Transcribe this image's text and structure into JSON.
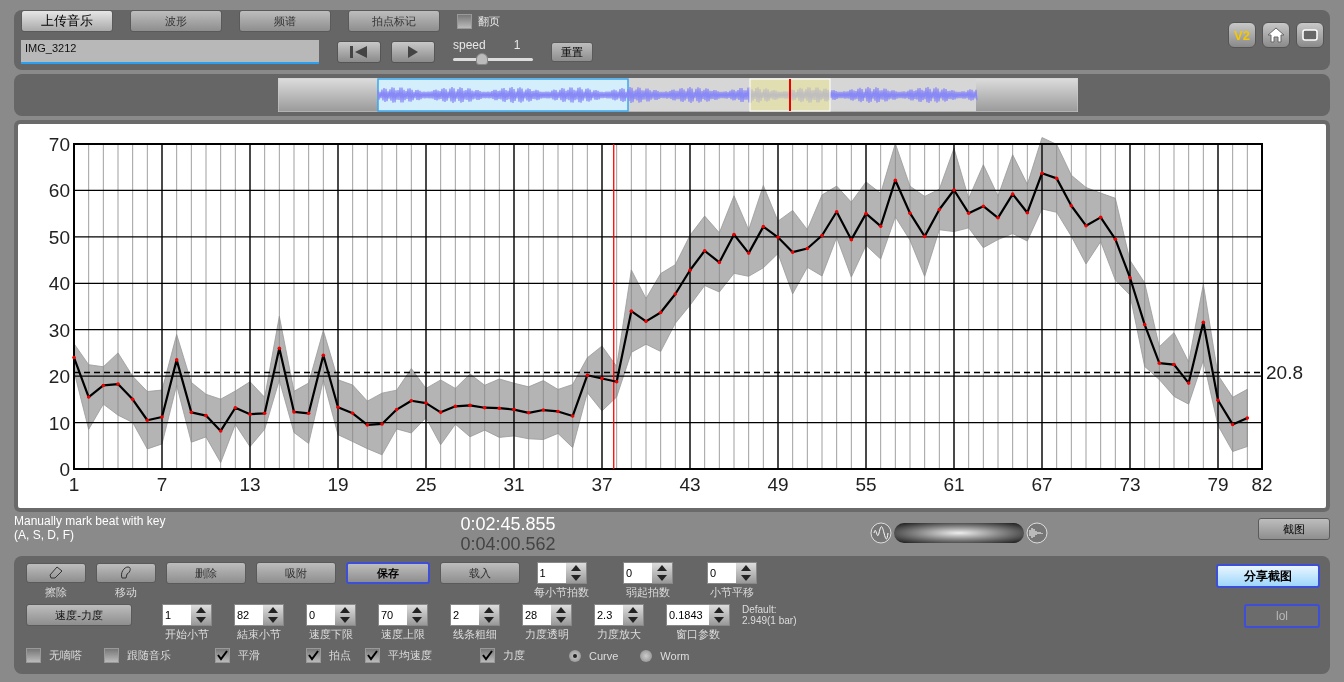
{
  "toolbar": {
    "buttons": [
      {
        "label": "上传音乐",
        "selected": true
      },
      {
        "label": "波形",
        "selected": false
      },
      {
        "label": "频谱",
        "selected": false
      },
      {
        "label": "拍点标记",
        "selected": false
      }
    ],
    "page_flip": {
      "label": "翻页",
      "checked": false
    },
    "file_name": "IMG_3212",
    "speed": {
      "label": "speed",
      "value": "1",
      "level": 0.35
    },
    "reset": "重置",
    "version": "V2"
  },
  "chart": {
    "chart_data": {
      "type": "line",
      "grid": true,
      "x": [
        1,
        2,
        3,
        4,
        5,
        6,
        7,
        8,
        9,
        10,
        11,
        12,
        13,
        14,
        15,
        16,
        17,
        18,
        19,
        20,
        21,
        22,
        23,
        24,
        25,
        26,
        27,
        28,
        29,
        30,
        31,
        32,
        33,
        34,
        35,
        36,
        37,
        38,
        39,
        40,
        41,
        42,
        43,
        44,
        45,
        46,
        47,
        48,
        49,
        50,
        51,
        52,
        53,
        54,
        55,
        56,
        57,
        58,
        59,
        60,
        61,
        62,
        63,
        64,
        65,
        66,
        67,
        68,
        69,
        70,
        71,
        72,
        73,
        74,
        75,
        76,
        77,
        78,
        79,
        80,
        81
      ],
      "series": [
        {
          "color": "#000000",
          "values": [
            24,
            15.5,
            18,
            18.3,
            15,
            10.5,
            11.2,
            23.5,
            12.2,
            11.5,
            8.2,
            13.2,
            11.8,
            12,
            26,
            12.3,
            12,
            24.5,
            13.3,
            12,
            9.5,
            9.7,
            12.8,
            14.7,
            14.2,
            12.2,
            13.5,
            13.7,
            13.2,
            13.1,
            12.8,
            12.1,
            12.7,
            12.4,
            11.4,
            20.2,
            19.5,
            18.8,
            34,
            31.8,
            33.7,
            37.7,
            42.8,
            47,
            44.5,
            50.5,
            46.5,
            52.2,
            49.9,
            46.7,
            47.5,
            50.3,
            55.4,
            49.4,
            55,
            52.3,
            62.2,
            55.1,
            50.1,
            55.9,
            60.1,
            55.1,
            56.6,
            54.1,
            59.2,
            55.2,
            63.7,
            62.6,
            56.7,
            52.4,
            54.2,
            49.5,
            41.2,
            31.1,
            22.8,
            22.5,
            18.5,
            31.6,
            14.8,
            9.6,
            11
          ]
        }
      ],
      "xlim": [
        1,
        82
      ],
      "ylim": [
        0,
        70
      ],
      "xticks": [
        1,
        7,
        13,
        19,
        25,
        31,
        37,
        43,
        49,
        55,
        61,
        67,
        73,
        79,
        82
      ],
      "yticks": [
        0,
        10,
        20,
        30,
        40,
        50,
        60,
        70
      ],
      "ref_lines": [
        {
          "axis": "y",
          "value": 20.8,
          "label": "20.8"
        },
        {
          "axis": "x",
          "value": 37.8,
          "color": "#ff0000"
        }
      ]
    }
  },
  "hint": [
    "Manually mark beat with key",
    "(A, S, D, F)"
  ],
  "time": {
    "current": "0:02:45.855",
    "total": "0:04:00.562"
  },
  "screenshot_button": "截图",
  "controls": {
    "tools": [
      {
        "kind": "icon",
        "label": "擦除",
        "selected": false
      },
      {
        "kind": "icon",
        "label": "移动",
        "selected": false
      },
      {
        "kind": "text",
        "label": "删除",
        "selected": false
      },
      {
        "kind": "text",
        "label": "吸附",
        "selected": false
      },
      {
        "kind": "text",
        "label": "保存",
        "selected": true
      },
      {
        "kind": "text",
        "label": "载入",
        "selected": false
      }
    ],
    "row1_spinners": [
      {
        "label": "每小节拍数",
        "value": "1"
      },
      {
        "label": "弱起拍数",
        "value": "0"
      },
      {
        "label": "小节平移",
        "value": "0"
      }
    ],
    "mode_button": "速度-力度",
    "row2_spinners": [
      {
        "label": "开始小节",
        "value": "1"
      },
      {
        "label": "結束小节",
        "value": "82"
      },
      {
        "label": "速度下限",
        "value": "0"
      },
      {
        "label": "速度上限",
        "value": "70"
      },
      {
        "label": "线条粗细",
        "value": "2"
      },
      {
        "label": "力度透明",
        "value": "28"
      },
      {
        "label": "力度放大",
        "value": "2.3"
      },
      {
        "label": "窗口参数",
        "value": "0.1843"
      }
    ],
    "default_note": [
      "Default:",
      "2.949(1 bar)"
    ],
    "options": [
      {
        "kind": "checkbox",
        "label": "无嘀嗒",
        "checked": false
      },
      {
        "kind": "checkbox",
        "label": "跟随音乐",
        "checked": false
      },
      {
        "kind": "checkbox",
        "label": "平滑",
        "checked": true
      },
      {
        "kind": "checkbox",
        "label": "拍点",
        "checked": true
      },
      {
        "kind": "checkbox",
        "label": "平均速度",
        "checked": true
      },
      {
        "kind": "checkbox",
        "label": "力度",
        "checked": true
      },
      {
        "kind": "radio",
        "label": "Curve",
        "selected": true
      },
      {
        "kind": "radio",
        "label": "Worm",
        "selected": false
      }
    ],
    "share_button": "分享截图",
    "disabled_button": {
      "label": "lol",
      "disabled": true
    }
  }
}
